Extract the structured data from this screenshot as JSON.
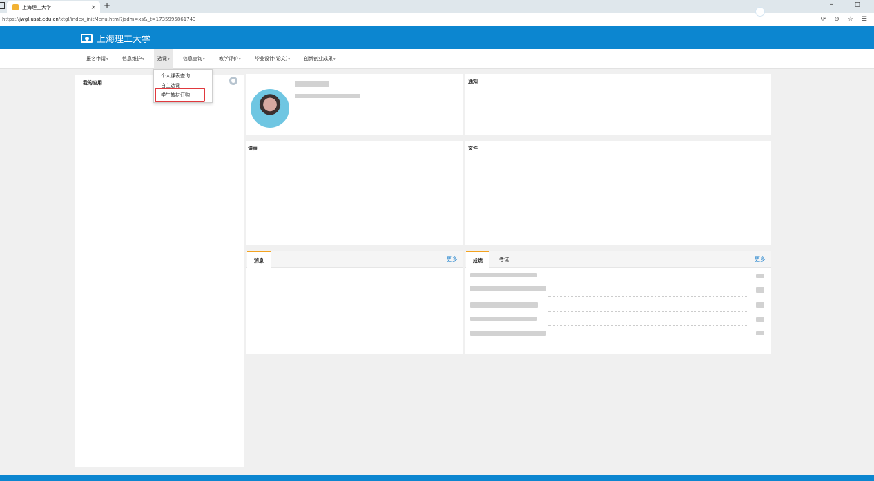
{
  "browser": {
    "tab_title": "上海理工大学",
    "close_glyph": "×",
    "newtab_glyph": "+",
    "window_controls": "–  ◻",
    "address_prefix": "https://",
    "address_domain": "jwgl.usst.edu.cn",
    "address_path": "/xtgl/index_initMenu.html?jsdm=xs&_t=1735995861743"
  },
  "header": {
    "school_name": "上海理工大学"
  },
  "nav": {
    "items": [
      "报名申请",
      "信息维护",
      "选课",
      "信息查询",
      "教学评价",
      "毕业设计(论文)",
      "创新创业成果"
    ],
    "caret": "▾"
  },
  "dropdown": {
    "items": [
      "个人课表查询",
      "自主选课",
      "学生教材订购"
    ]
  },
  "panels": {
    "my_apps": "我的应用",
    "notice": "通知",
    "schedule": "课表",
    "files": "文件",
    "messages_tab": "消息",
    "grades_tab": "成绩",
    "exam_tab": "考试",
    "more": "更多"
  },
  "colors": {
    "brand": "#0c86d0",
    "tab_accent": "#f3a321",
    "highlight": "#e0393e"
  }
}
